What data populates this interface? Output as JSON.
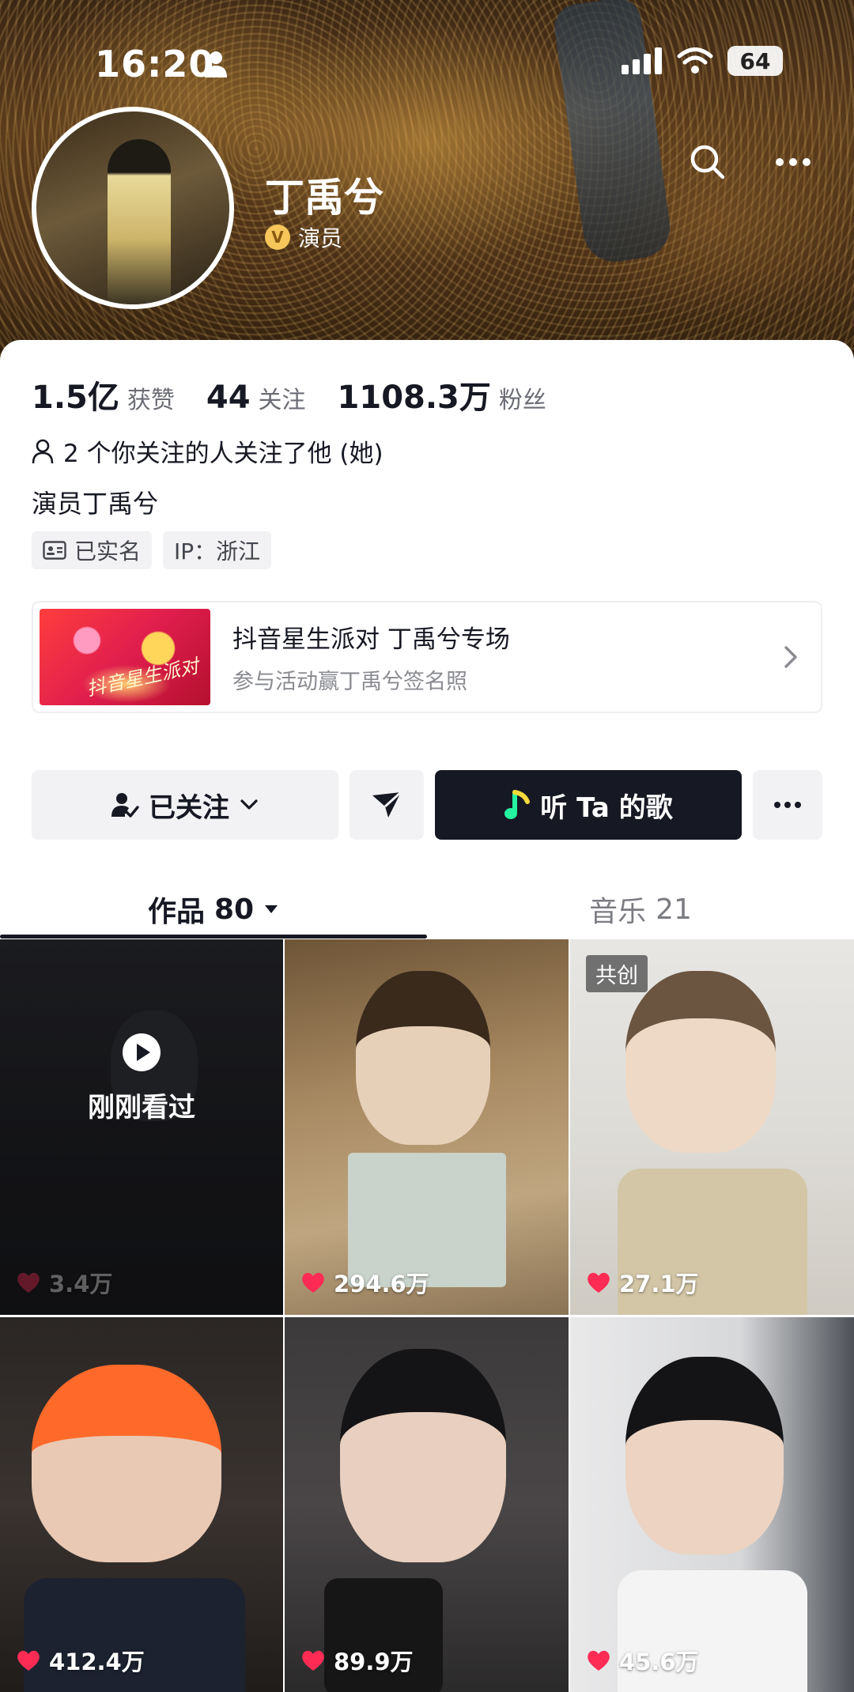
{
  "status_bar": {
    "time": "16:20",
    "battery": "64"
  },
  "profile": {
    "name": "丁禹兮",
    "verify_badge": "V",
    "verified_label": "演员",
    "stats": [
      {
        "value": "1.5亿",
        "label": "获赞"
      },
      {
        "value": "44",
        "label": "关注"
      },
      {
        "value": "1108.3万",
        "label": "粉丝"
      }
    ],
    "mutual_text": "2 个你关注的人关注了他 (她)",
    "bio": "演员丁禹兮",
    "tags": {
      "realname": "已实名",
      "ip": "IP：浙江"
    }
  },
  "promo": {
    "image_text": "抖音星生派对",
    "title": "抖音星生派对 丁禹兮专场",
    "subtitle": "参与活动赢丁禹兮签名照"
  },
  "actions": {
    "follow_label": "已关注",
    "music_label": "听 Ta 的歌"
  },
  "tabs": [
    {
      "label": "作品",
      "count": "80"
    },
    {
      "label": "音乐",
      "count": "21"
    }
  ],
  "videos": [
    {
      "likes": "3.4万",
      "overlay": "刚刚看过"
    },
    {
      "likes": "294.6万"
    },
    {
      "likes": "27.1万",
      "badge": "共创"
    },
    {
      "likes": "412.4万"
    },
    {
      "likes": "89.9万"
    },
    {
      "likes": "45.6万"
    }
  ],
  "colors": {
    "accent_dark": "#161823",
    "like_red": "#fe2c55",
    "music_green": "#25f4a0"
  }
}
